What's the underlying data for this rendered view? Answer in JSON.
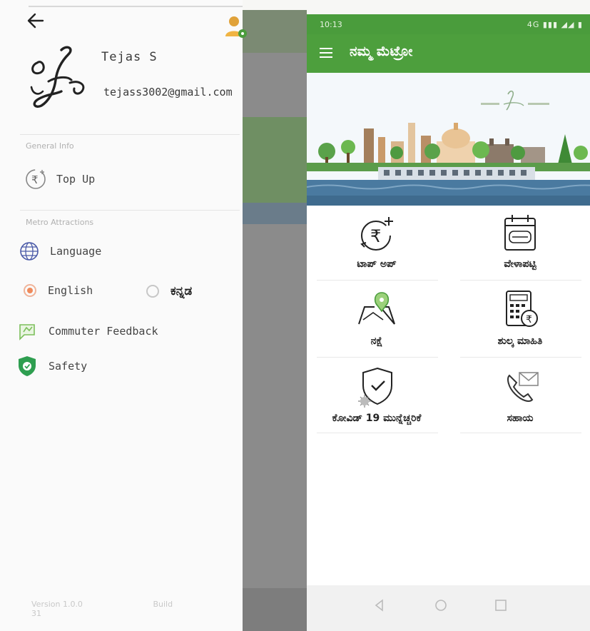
{
  "drawer": {
    "user_name": "Tejas S",
    "user_email": "tejass3002@gmail.com",
    "section_general": "General Info",
    "section_metro": "Metro Attractions",
    "topup_label": "Top Up",
    "language_label": "Language",
    "radio_english": "English",
    "radio_kannada": "ಕನ್ನಡ",
    "selected_language": "English",
    "feedback_label": "Commuter Feedback",
    "safety_label": "Safety",
    "footer_version": "Version 1.0.0",
    "footer_build": "Build 31"
  },
  "statusbar": {
    "time": "10:13",
    "icons": "4G ▮▮▮ ◢◢ ▮"
  },
  "app": {
    "title": "ನಮ್ಮ ಮೆಟ್ರೋ",
    "tiles": [
      {
        "label": "ಟಾಪ್ ಅಪ್",
        "icon": "rupee-topup-icon"
      },
      {
        "label": "ವೇಳಾಪಟ್ಟಿ",
        "icon": "timetable-icon"
      },
      {
        "label": "ನಕ್ಷೆ",
        "icon": "map-icon"
      },
      {
        "label": "ಶುಲ್ಕ ಮಾಹಿತಿ",
        "icon": "fare-calculator-icon"
      },
      {
        "label": "ಕೋವಿಡ್ 19 ಮುನ್ನೆಚ್ಚರಿಕೆ",
        "icon": "covid-shield-icon"
      },
      {
        "label": "ಸಹಾಯ",
        "icon": "help-phone-icon"
      }
    ]
  },
  "colors": {
    "primary_green": "#4d9f3d",
    "radio_selected": "#ef8a5b",
    "safety_green": "#2e9e50"
  }
}
